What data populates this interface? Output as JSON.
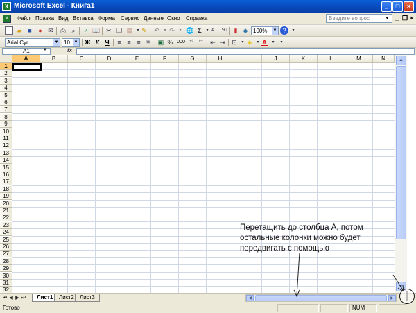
{
  "window": {
    "title": "Microsoft Excel - Книга1",
    "app_icon": "excel-icon",
    "controls": [
      "minimize",
      "maximize",
      "close"
    ]
  },
  "menubar": {
    "items": [
      "Файл",
      "Правка",
      "Вид",
      "Вставка",
      "Формат",
      "Сервис",
      "Данные",
      "Окно",
      "Справка"
    ],
    "help_placeholder": "Введите вопрос"
  },
  "toolbar_standard": {
    "zoom": "100%"
  },
  "toolbar_format": {
    "font": "Arial Cyr",
    "size": "10",
    "bold": "Ж",
    "italic": "К",
    "underline": "Ч",
    "percent": "%",
    "thousands": "000",
    "font_color_letter": "A"
  },
  "formula_bar": {
    "name_box": "A1",
    "fx": "fx",
    "value": ""
  },
  "sheet": {
    "columns": [
      "A",
      "B",
      "C",
      "D",
      "E",
      "F",
      "G",
      "H",
      "I",
      "J",
      "K",
      "L",
      "M",
      "N"
    ],
    "rows": [
      "1",
      "2",
      "3",
      "4",
      "5",
      "6",
      "7",
      "8",
      "9",
      "10",
      "11",
      "12",
      "13",
      "14",
      "15",
      "16",
      "17",
      "18",
      "19",
      "20",
      "21",
      "22",
      "23",
      "24",
      "25",
      "26",
      "27",
      "28",
      "29",
      "30",
      "31",
      "32"
    ],
    "active_cell": "A1"
  },
  "tabs": {
    "sheets": [
      "Лист1",
      "Лист2",
      "Лист3"
    ],
    "active": "Лист1"
  },
  "status": {
    "text": "Готово",
    "num": "NUM"
  },
  "annotation": {
    "text": "Перетащить до столбца А, потом остальные колонки можно будет передвигать с помощью"
  }
}
